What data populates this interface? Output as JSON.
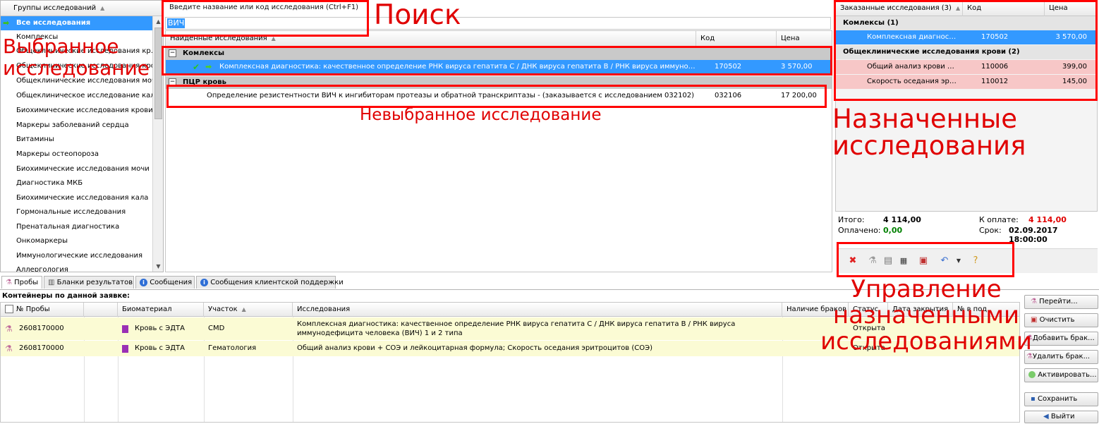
{
  "colors": {
    "accent": "#3399ff",
    "annotation": "#ff0000",
    "group_bg": "#c9c9c9",
    "ordered_pink": "#f7c7c7",
    "row_yellow": "#fbfbd4",
    "total_red": "#e00000",
    "paid_green": "#008000"
  },
  "left": {
    "header": "Группы исследований",
    "items": [
      "Все исследования",
      "Комплексы",
      "Общеклинические исследования кр...",
      "Общеклинические исследования кро...",
      "Общеклинические исследования мочи",
      "Общеклиническое исследование кала",
      "Биохимические исследования крови",
      "Маркеры заболеваний сердца",
      "Витамины",
      "Маркеры остеопороза",
      "Биохимические исследования мочи",
      "Диагностика МКБ",
      "Биохимические исследования кала",
      "Гормональные исследования",
      "Пренатальная диагностика",
      "Онкомаркеры",
      "Иммунологические исследования",
      "Аллергология"
    ]
  },
  "search": {
    "placeholder": "Введите название или код исследования (Ctrl+F1)",
    "value": "ВИЧ"
  },
  "found": {
    "headers": {
      "name": "Найденные исследования",
      "code": "Код",
      "price": "Цена"
    },
    "group1": "Комлексы",
    "row1": {
      "name": "Комплексная диагностика: качественное определение РНК вируса гепатита С / ДНК вируса гепатита В / РНК вируса иммунодефицита че...",
      "code": "170502",
      "price": "3 570,00"
    },
    "group2": "ПЦР кровь",
    "row2": {
      "name": "Определение резистентности ВИЧ к ингибиторам протеазы и обратной транскриптазы - (заказывается с исследованием 032102)",
      "code": "032106",
      "price": "17 200,00"
    }
  },
  "ordered": {
    "headers": {
      "name": "Заказанные исследования (3)",
      "code": "Код",
      "price": "Цена"
    },
    "group1": "Комлексы (1)",
    "row1": {
      "name": "Комплексная диагностик...",
      "code": "170502",
      "price": "3 570,00"
    },
    "group2": "Общеклинические исследования крови (2)",
    "row2": {
      "name": "Общий анализ крови + С...",
      "code": "110006",
      "price": "399,00"
    },
    "row3": {
      "name": "Скорость оседания эрит...",
      "code": "110012",
      "price": "145,00"
    }
  },
  "totals": {
    "total_label": "Итого:",
    "total_value": "4 114,00",
    "paid_label": "Оплачено:",
    "paid_value": "0,00",
    "topay_label": "К оплате:",
    "topay_value": "4 114,00",
    "due_label": "Срок:",
    "due_value": "02.09.2017 18:00:00"
  },
  "tabs": [
    "Пробы",
    "Бланки результатов",
    "Сообщения",
    "Сообщения клиентской поддержки"
  ],
  "containers": {
    "title": "Контейнеры по данной заявке:",
    "headers": {
      "probe": "№ Пробы",
      "bio": "Биоматериал",
      "section": "Участок",
      "research": "Исследования",
      "defects": "Наличие браков",
      "status": "Статус",
      "closed": "Дата закрытия",
      "num": "№ в под."
    },
    "rows": [
      {
        "probe": "2608170000",
        "bio": "Кровь с ЭДТА",
        "section": "CMD",
        "research": "Комплексная диагностика: качественное определение РНК вируса гепатита С / ДНК вируса гепатита В / РНК вируса иммунодефицита человека (ВИЧ) 1 и 2 типа",
        "status": "Открыта"
      },
      {
        "probe": "2608170000",
        "bio": "Кровь с ЭДТА",
        "section": "Гематология",
        "research": "Общий анализ крови + СОЭ и лейкоцитарная формула; Скорость оседания эритроцитов (СОЭ)",
        "status": "Открыта"
      }
    ]
  },
  "buttons": {
    "goto": "Перейти...",
    "clear": "Очистить",
    "add_defect": "Добавить брак...",
    "del_defect": "Удалить брак...",
    "activate": "Активировать...",
    "save": "Сохранить",
    "exit": "Выйти"
  },
  "annotations": {
    "search": "Поиск",
    "selected": "Выбранное исследование",
    "unselected": "Невыбранное исследование",
    "assigned": "Назначенные исследования",
    "manage": "Управление назначенными исследованиями"
  }
}
